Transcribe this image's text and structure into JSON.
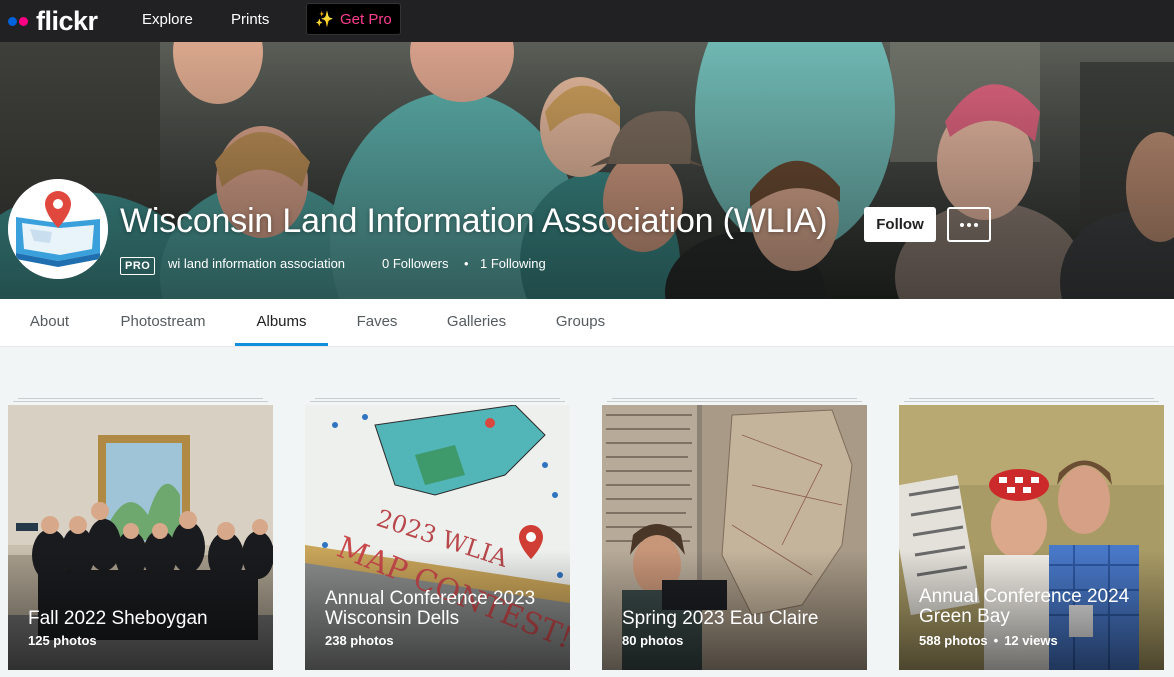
{
  "topnav": {
    "logo_text": "flickr",
    "links": [
      "Explore",
      "Prints"
    ],
    "get_pro_label": "Get Pro"
  },
  "profile": {
    "name": "Wisconsin Land Information Association (WLIA)",
    "pro_badge": "PRO",
    "username": "wi land information association",
    "followers": "0 Followers",
    "following": "1 Following",
    "follow_label": "Follow"
  },
  "tabs": [
    {
      "label": "About",
      "active": false
    },
    {
      "label": "Photostream",
      "active": false
    },
    {
      "label": "Albums",
      "active": true
    },
    {
      "label": "Faves",
      "active": false
    },
    {
      "label": "Galleries",
      "active": false
    },
    {
      "label": "Groups",
      "active": false
    }
  ],
  "albums": [
    {
      "title_lines": [
        "Fall 2022 Sheboygan"
      ],
      "photos": "125 photos",
      "views": ""
    },
    {
      "title_lines": [
        "Annual Conference 2023",
        "Wisconsin Dells"
      ],
      "photos": "238 photos",
      "views": ""
    },
    {
      "title_lines": [
        "Spring 2023 Eau Claire"
      ],
      "photos": "80 photos",
      "views": ""
    },
    {
      "title_lines": [
        "Annual Conference 2024",
        "Green Bay"
      ],
      "photos": "588 photos",
      "views": "12 views"
    }
  ],
  "colors": {
    "nav_bg": "#212124",
    "brand_blue": "#0063dc",
    "brand_pink": "#ff0084",
    "active_tab": "#128fdc",
    "get_pro_text": "#ff3d8f"
  },
  "icons": {
    "more": "more-dots-icon",
    "sparkle": "sparkle-icon",
    "avatar": "map-pin-logo"
  }
}
